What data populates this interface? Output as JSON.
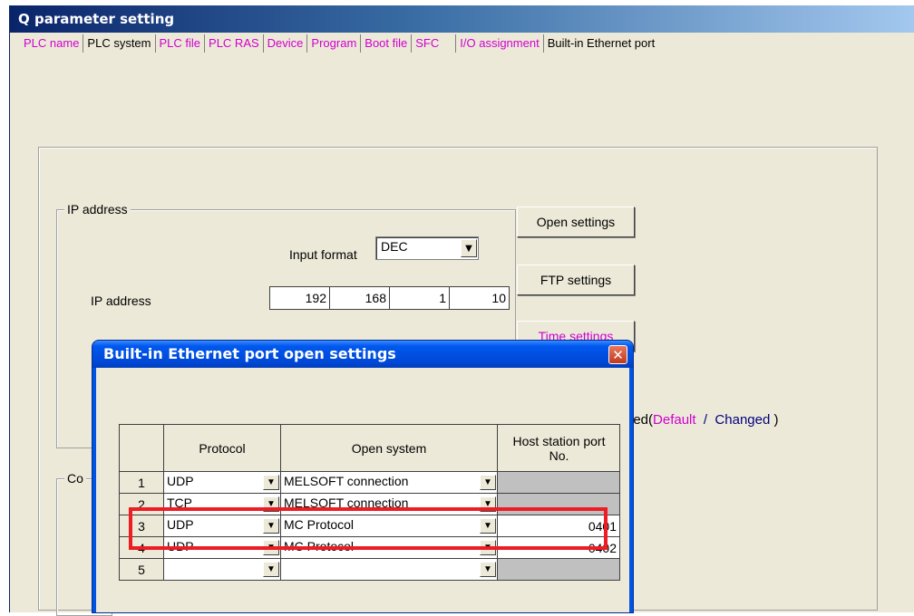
{
  "window": {
    "title": "Q parameter setting"
  },
  "tabs": [
    {
      "label": "PLC name",
      "active": false
    },
    {
      "label": "PLC system",
      "active": false
    },
    {
      "label": "PLC file",
      "active": false
    },
    {
      "label": "PLC RAS",
      "active": false
    },
    {
      "label": "Device",
      "active": false
    },
    {
      "label": "Program",
      "active": false
    },
    {
      "label": "Boot file",
      "active": false
    },
    {
      "label": "SFC",
      "active": false
    },
    {
      "label": "I/O assignment",
      "active": false
    },
    {
      "label": "Built-in Ethernet port",
      "active": true
    }
  ],
  "ip_group": {
    "legend": "IP address",
    "input_format_label": "Input format",
    "input_format_value": "DEC",
    "ip_address_label": "IP address",
    "ip_octets": [
      "192",
      "168",
      "1",
      "10"
    ]
  },
  "comm_group": {
    "legend_fragment": "Co"
  },
  "buttons": {
    "open_settings": "Open settings",
    "ftp_settings": "FTP settings",
    "time_settings": "Time settings"
  },
  "legend": {
    "prefix": "ded(",
    "default": "Default",
    "slash": "/",
    "changed": "Changed",
    "suffix": ")"
  },
  "dialog": {
    "title": "Built-in Ethernet port open settings",
    "close_glyph": "✕",
    "headers": {
      "protocol": "Protocol",
      "open_system": "Open system",
      "port": "Host station port No."
    },
    "rows": [
      {
        "num": "1",
        "protocol": "UDP",
        "open_system": "MELSOFT connection",
        "port": ""
      },
      {
        "num": "2",
        "protocol": "TCP",
        "open_system": "MELSOFT connection",
        "port": ""
      },
      {
        "num": "3",
        "protocol": "UDP",
        "open_system": "MC Protocol",
        "port": "0401"
      },
      {
        "num": "4",
        "protocol": "UDP",
        "open_system": "MC Protocol",
        "port": "0402"
      },
      {
        "num": "5",
        "protocol": "",
        "open_system": "",
        "port": ""
      }
    ]
  },
  "colors": {
    "tab_inactive": "#d000d0",
    "highlight": "#ee1c24",
    "dialog_title": "#0054e3"
  }
}
